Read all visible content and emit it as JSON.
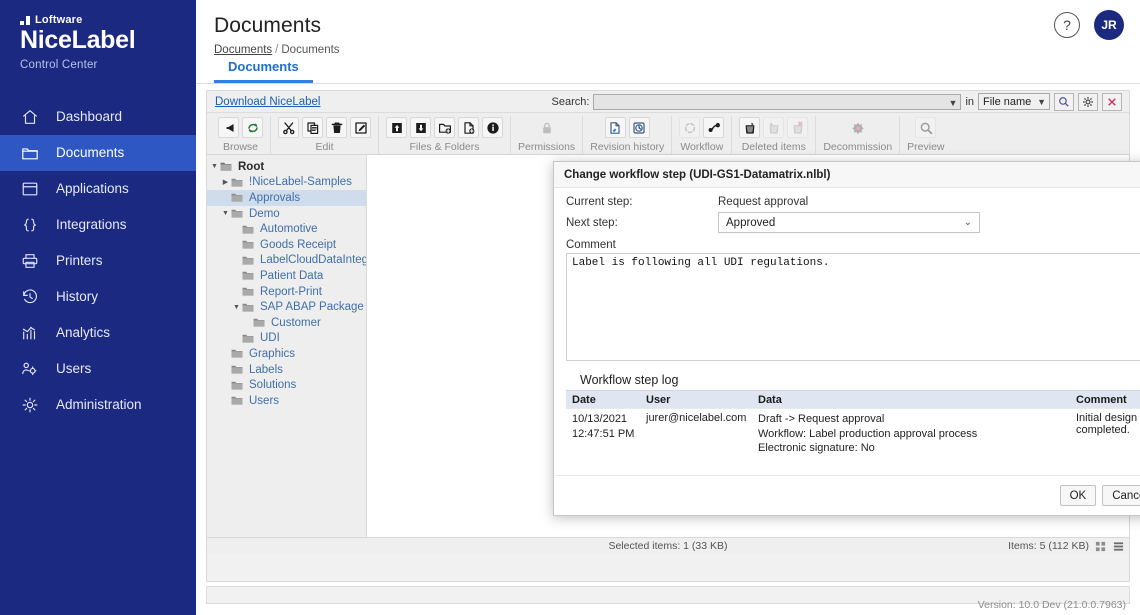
{
  "brand": {
    "company": "Loftware",
    "product": "NiceLabel",
    "subtitle": "Control Center"
  },
  "sidebar": {
    "items": [
      {
        "label": "Dashboard",
        "icon": "home-icon",
        "active": false
      },
      {
        "label": "Documents",
        "icon": "folder-icon",
        "active": true
      },
      {
        "label": "Applications",
        "icon": "window-icon",
        "active": false
      },
      {
        "label": "Integrations",
        "icon": "braces-icon",
        "active": false
      },
      {
        "label": "Printers",
        "icon": "printer-icon",
        "active": false
      },
      {
        "label": "History",
        "icon": "clock-history-icon",
        "active": false
      },
      {
        "label": "Analytics",
        "icon": "bar-chart-icon",
        "active": false
      },
      {
        "label": "Users",
        "icon": "users-gear-icon",
        "active": false
      },
      {
        "label": "Administration",
        "icon": "gear-icon",
        "active": false
      }
    ]
  },
  "header": {
    "title": "Documents",
    "breadcrumb": {
      "root": "Documents",
      "separator": "/",
      "current": "Documents"
    },
    "help_icon": "question-circle-icon",
    "avatar_initials": "JR",
    "tab_label": "Documents"
  },
  "toolbar": {
    "download_link": "Download NiceLabel",
    "search_label": "Search:",
    "search_value": "",
    "in_label": "in",
    "scope_value": "File name",
    "search_button_icon": "magnifier-icon",
    "settings_button_icon": "gear-icon",
    "close_button_icon": "close-x-icon"
  },
  "ribbon": {
    "groups": [
      {
        "label": "Browse",
        "dim": false,
        "buttons": [
          {
            "icon": "back-arrow-icon",
            "dim": false
          },
          {
            "icon": "refresh-icon",
            "dim": false
          }
        ]
      },
      {
        "label": "Edit",
        "dim": false,
        "buttons": [
          {
            "icon": "scissors-icon",
            "dim": false
          },
          {
            "icon": "copy-icon",
            "dim": false
          },
          {
            "icon": "trash-icon",
            "dim": false
          },
          {
            "icon": "rename-edit-icon",
            "dim": false
          }
        ]
      },
      {
        "label": "Files & Folders",
        "dim": false,
        "buttons": [
          {
            "icon": "upload-icon",
            "dim": false
          },
          {
            "icon": "download-icon",
            "dim": false
          },
          {
            "icon": "new-folder-icon",
            "dim": false
          },
          {
            "icon": "new-file-icon",
            "dim": false
          },
          {
            "icon": "info-icon",
            "dim": false
          }
        ]
      },
      {
        "label": "Permissions",
        "dim": true,
        "buttons": [
          {
            "icon": "lock-icon",
            "dim": true
          }
        ]
      },
      {
        "label": "Revision history",
        "dim": false,
        "buttons": [
          {
            "icon": "document-revision-icon",
            "dim": false
          },
          {
            "icon": "history-clock-icon",
            "dim": false
          }
        ]
      },
      {
        "label": "Workflow",
        "dim": false,
        "buttons": [
          {
            "icon": "workflow-cycle-icon",
            "dim": true
          },
          {
            "icon": "workflow-step-icon",
            "dim": false
          }
        ]
      },
      {
        "label": "Deleted items",
        "dim": false,
        "buttons": [
          {
            "icon": "delete-permanently-icon",
            "dim": false
          },
          {
            "icon": "restore-item-icon",
            "dim": true
          },
          {
            "icon": "purge-item-icon",
            "dim": true
          }
        ]
      },
      {
        "label": "Decommission",
        "dim": true,
        "buttons": [
          {
            "icon": "decommission-icon",
            "dim": true
          }
        ]
      },
      {
        "label": "Preview",
        "dim": true,
        "buttons": [
          {
            "icon": "preview-magnifier-icon",
            "dim": true
          }
        ]
      }
    ]
  },
  "tree": {
    "nodes": [
      {
        "label": "Root",
        "depth": 0,
        "twisty": "down",
        "selected": false,
        "root": true
      },
      {
        "label": "!NiceLabel-Samples",
        "depth": 1,
        "twisty": "right",
        "selected": false,
        "root": false
      },
      {
        "label": "Approvals",
        "depth": 1,
        "twisty": "none",
        "selected": true,
        "root": false
      },
      {
        "label": "Demo",
        "depth": 1,
        "twisty": "down",
        "selected": false,
        "root": false
      },
      {
        "label": "Automotive",
        "depth": 2,
        "twisty": "none",
        "selected": false,
        "root": false
      },
      {
        "label": "Goods Receipt",
        "depth": 2,
        "twisty": "none",
        "selected": false,
        "root": false
      },
      {
        "label": "LabelCloudDataIntegrat",
        "depth": 2,
        "twisty": "none",
        "selected": false,
        "root": false
      },
      {
        "label": "Patient Data",
        "depth": 2,
        "twisty": "none",
        "selected": false,
        "root": false
      },
      {
        "label": "Report-Print",
        "depth": 2,
        "twisty": "none",
        "selected": false,
        "root": false
      },
      {
        "label": "SAP ABAP Package",
        "depth": 2,
        "twisty": "down",
        "selected": false,
        "root": false
      },
      {
        "label": "Customer",
        "depth": 3,
        "twisty": "none",
        "selected": false,
        "root": false
      },
      {
        "label": "UDI",
        "depth": 2,
        "twisty": "none",
        "selected": false,
        "root": false
      },
      {
        "label": "Graphics",
        "depth": 1,
        "twisty": "none",
        "selected": false,
        "root": false
      },
      {
        "label": "Labels",
        "depth": 1,
        "twisty": "none",
        "selected": false,
        "root": false
      },
      {
        "label": "Solutions",
        "depth": 1,
        "twisty": "none",
        "selected": false,
        "root": false
      },
      {
        "label": "Users",
        "depth": 1,
        "twisty": "none",
        "selected": false,
        "root": false
      }
    ]
  },
  "status": {
    "selected_items": "Selected items: 1 (33 KB)",
    "items": "Items: 5 (112 KB)",
    "view_tiles_icon": "tile-view-icon",
    "view_list_icon": "list-view-icon"
  },
  "footer": {
    "version": "Version: 10.0 Dev (21.0.0.7963)"
  },
  "dialog": {
    "title": "Change workflow step (UDI-GS1-Datamatrix.nlbl)",
    "close_icon": "close-x-icon",
    "current_step_label": "Current step:",
    "current_step_value": "Request approval",
    "next_step_label": "Next step:",
    "next_step_value": "Approved",
    "next_step_caret_icon": "chevron-down-icon",
    "comment_label": "Comment",
    "comment_value": "Label is following all UDI regulations.",
    "log_title": "Workflow step log",
    "log_columns": [
      "Date",
      "User",
      "Data",
      "Comment"
    ],
    "log_rows": [
      {
        "date_line1": "10/13/2021",
        "date_line2": "12:47:51 PM",
        "user": "jurer@nicelabel.com",
        "data_line1": "Draft -> Request approval",
        "data_line2": "Workflow: Label production approval process",
        "data_line3": "Electronic signature: No",
        "comment": "Initial design completed."
      }
    ],
    "ok_label": "OK",
    "cancel_label": "Cancel"
  },
  "colors": {
    "sidebar_bg": "#1b2a80",
    "sidebar_active": "#2f57c4",
    "accent_link": "#1d6fd0",
    "tree_selected": "#cfdcec",
    "table_header": "#dfe6f1"
  }
}
